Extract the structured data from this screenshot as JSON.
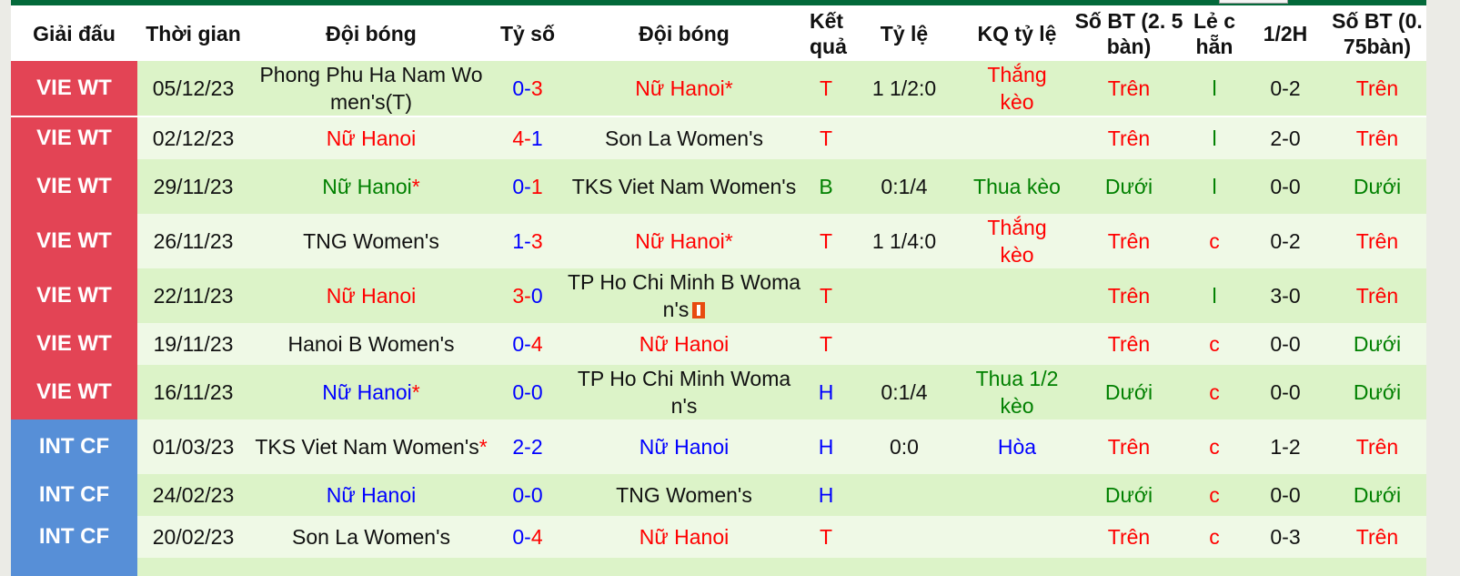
{
  "headers": {
    "league": "Giải đấu",
    "time": "Thời gian",
    "home": "Đội bóng",
    "score": "Tỷ số",
    "away": "Đội bóng",
    "result": "Kết quả",
    "odds": "Tỷ lệ",
    "odds_result": "KQ tỷ lệ",
    "goals_25": "Số BT (2. 5bàn)",
    "odd_even": "Lẻ c hẵn",
    "half": "1/2H",
    "goals_075": "Số BT (0. 75bàn)"
  },
  "colors": {
    "vie_badge": "#e34455",
    "int_badge": "#578fd7",
    "row_odd": "#dcf3c8",
    "row_even": "#eff9e6",
    "header_bar": "#03693a",
    "win": "#ff0000",
    "draw": "#0000ff",
    "loss": "#008000"
  },
  "rows": [
    {
      "league": "VIE WT",
      "league_type": "vie",
      "date": "05/12/23",
      "home": "Phong Phu Ha Nam Women's(T)",
      "home_color": "black",
      "home_star": "",
      "score_home": "0",
      "score_home_color": "blue",
      "score_away": "3",
      "score_away_color": "red",
      "away": "Nữ Hanoi",
      "away_color": "red",
      "away_star": "*",
      "result": "T",
      "result_color": "red",
      "odds": "1 1/2:0",
      "odds_result": "Thắng kèo",
      "odds_result_color": "red",
      "goals_25": "Trên",
      "goals_25_color": "red",
      "odd_even": "l",
      "odd_even_color": "green",
      "half": "0-2",
      "goals_075": "Trên",
      "goals_075_color": "red",
      "red_card": false,
      "tall": true
    },
    {
      "league": "VIE WT",
      "league_type": "vie",
      "date": "02/12/23",
      "home": "Nữ Hanoi",
      "home_color": "red",
      "home_star": "",
      "score_home": "4",
      "score_home_color": "red",
      "score_away": "1",
      "score_away_color": "blue",
      "away": "Son La Women's",
      "away_color": "black",
      "away_star": "",
      "result": "T",
      "result_color": "red",
      "odds": "",
      "odds_result": "",
      "odds_result_color": "black",
      "goals_25": "Trên",
      "goals_25_color": "red",
      "odd_even": "l",
      "odd_even_color": "green",
      "half": "2-0",
      "goals_075": "Trên",
      "goals_075_color": "red",
      "red_card": false,
      "tall": false
    },
    {
      "league": "VIE WT",
      "league_type": "vie",
      "date": "29/11/23",
      "home": "Nữ Hanoi",
      "home_color": "green",
      "home_star": "*",
      "score_home": "0",
      "score_home_color": "blue",
      "score_away": "1",
      "score_away_color": "red",
      "away": "TKS Viet Nam Women's",
      "away_color": "black",
      "away_star": "",
      "result": "B",
      "result_color": "green",
      "odds": "0:1/4",
      "odds_result": "Thua kèo",
      "odds_result_color": "green",
      "goals_25": "Dưới",
      "goals_25_color": "green",
      "odd_even": "l",
      "odd_even_color": "green",
      "half": "0-0",
      "goals_075": "Dưới",
      "goals_075_color": "green",
      "red_card": false,
      "tall": true
    },
    {
      "league": "VIE WT",
      "league_type": "vie",
      "date": "26/11/23",
      "home": "TNG Women's",
      "home_color": "black",
      "home_star": "",
      "score_home": "1",
      "score_home_color": "blue",
      "score_away": "3",
      "score_away_color": "red",
      "away": "Nữ Hanoi",
      "away_color": "red",
      "away_star": "*",
      "result": "T",
      "result_color": "red",
      "odds": "1 1/4:0",
      "odds_result": "Thắng kèo",
      "odds_result_color": "red",
      "goals_25": "Trên",
      "goals_25_color": "red",
      "odd_even": "c",
      "odd_even_color": "red",
      "half": "0-2",
      "goals_075": "Trên",
      "goals_075_color": "red",
      "red_card": false,
      "tall": false
    },
    {
      "league": "VIE WT",
      "league_type": "vie",
      "date": "22/11/23",
      "home": "Nữ Hanoi",
      "home_color": "red",
      "home_star": "",
      "score_home": "3",
      "score_home_color": "red",
      "score_away": "0",
      "score_away_color": "blue",
      "away": "TP Ho Chi Minh B Woman's",
      "away_color": "black",
      "away_star": "",
      "result": "T",
      "result_color": "red",
      "odds": "",
      "odds_result": "",
      "odds_result_color": "black",
      "goals_25": "Trên",
      "goals_25_color": "red",
      "odd_even": "l",
      "odd_even_color": "green",
      "half": "3-0",
      "goals_075": "Trên",
      "goals_075_color": "red",
      "red_card": true,
      "tall": true
    },
    {
      "league": "VIE WT",
      "league_type": "vie",
      "date": "19/11/23",
      "home": "Hanoi B Women's",
      "home_color": "black",
      "home_star": "",
      "score_home": "0",
      "score_home_color": "blue",
      "score_away": "4",
      "score_away_color": "red",
      "away": "Nữ Hanoi",
      "away_color": "red",
      "away_star": "",
      "result": "T",
      "result_color": "red",
      "odds": "",
      "odds_result": "",
      "odds_result_color": "black",
      "goals_25": "Trên",
      "goals_25_color": "red",
      "odd_even": "c",
      "odd_even_color": "red",
      "half": "0-0",
      "goals_075": "Dưới",
      "goals_075_color": "green",
      "red_card": false,
      "tall": false
    },
    {
      "league": "VIE WT",
      "league_type": "vie",
      "date": "16/11/23",
      "home": "Nữ Hanoi",
      "home_color": "blue",
      "home_star": "*",
      "score_home": "0",
      "score_home_color": "blue",
      "score_away": "0",
      "score_away_color": "blue",
      "away": "TP Ho Chi Minh Woman's",
      "away_color": "black",
      "away_star": "",
      "result": "H",
      "result_color": "blue",
      "odds": "0:1/4",
      "odds_result": "Thua 1/2 kèo",
      "odds_result_color": "green",
      "goals_25": "Dưới",
      "goals_25_color": "green",
      "odd_even": "c",
      "odd_even_color": "red",
      "half": "0-0",
      "goals_075": "Dưới",
      "goals_075_color": "green",
      "red_card": false,
      "tall": true
    },
    {
      "league": "INT CF",
      "league_type": "int",
      "date": "01/03/23",
      "home": "TKS Viet Nam Women's",
      "home_color": "black",
      "home_star": "*",
      "score_home": "2",
      "score_home_color": "blue",
      "score_away": "2",
      "score_away_color": "blue",
      "away": "Nữ Hanoi",
      "away_color": "blue",
      "away_star": "",
      "result": "H",
      "result_color": "blue",
      "odds": "0:0",
      "odds_result": "Hòa",
      "odds_result_color": "blue",
      "goals_25": "Trên",
      "goals_25_color": "red",
      "odd_even": "c",
      "odd_even_color": "red",
      "half": "1-2",
      "goals_075": "Trên",
      "goals_075_color": "red",
      "red_card": false,
      "tall": true
    },
    {
      "league": "INT CF",
      "league_type": "int",
      "date": "24/02/23",
      "home": "Nữ Hanoi",
      "home_color": "blue",
      "home_star": "",
      "score_home": "0",
      "score_home_color": "blue",
      "score_away": "0",
      "score_away_color": "blue",
      "away": "TNG Women's",
      "away_color": "black",
      "away_star": "",
      "result": "H",
      "result_color": "blue",
      "odds": "",
      "odds_result": "",
      "odds_result_color": "black",
      "goals_25": "Dưới",
      "goals_25_color": "green",
      "odd_even": "c",
      "odd_even_color": "red",
      "half": "0-0",
      "goals_075": "Dưới",
      "goals_075_color": "green",
      "red_card": false,
      "tall": false
    },
    {
      "league": "INT CF",
      "league_type": "int",
      "date": "20/02/23",
      "home": "Son La Women's",
      "home_color": "black",
      "home_star": "",
      "score_home": "0",
      "score_home_color": "blue",
      "score_away": "4",
      "score_away_color": "red",
      "away": "Nữ Hanoi",
      "away_color": "red",
      "away_star": "",
      "result": "T",
      "result_color": "red",
      "odds": "",
      "odds_result": "",
      "odds_result_color": "black",
      "goals_25": "Trên",
      "goals_25_color": "red",
      "odd_even": "c",
      "odd_even_color": "red",
      "half": "0-3",
      "goals_075": "Trên",
      "goals_075_color": "red",
      "red_card": false,
      "tall": false
    }
  ]
}
